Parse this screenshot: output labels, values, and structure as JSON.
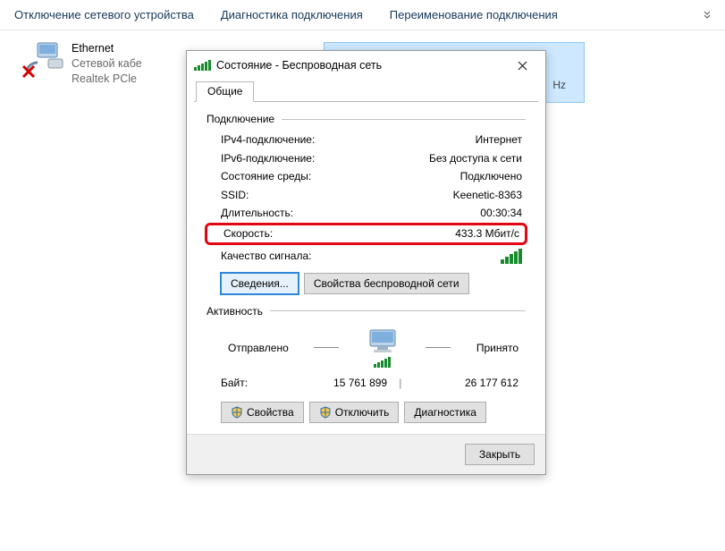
{
  "bg": {
    "toolbar": {
      "disable": "Отключение сетевого устройства",
      "diagnose": "Диагностика подключения",
      "rename": "Переименование подключения"
    },
    "ethernet": {
      "title": "Ethernet",
      "sub1": "Сетевой кабе",
      "sub2": "Realtek PCle"
    },
    "ghost_hz": "Hz"
  },
  "dialog": {
    "title": "Состояние - Беспроводная сеть",
    "tab": "Общие",
    "group_connection": "Подключение",
    "rows": {
      "ipv4_l": "IPv4-подключение:",
      "ipv4_v": "Интернет",
      "ipv6_l": "IPv6-подключение:",
      "ipv6_v": "Без доступа к сети",
      "media_l": "Состояние среды:",
      "media_v": "Подключено",
      "ssid_l": "SSID:",
      "ssid_v": "Keenetic-8363",
      "dur_l": "Длительность:",
      "dur_v": "00:30:34",
      "speed_l": "Скорость:",
      "speed_v": "433.3 Мбит/с",
      "signal_l": "Качество сигнала:"
    },
    "buttons": {
      "details": "Сведения...",
      "wifi_props": "Свойства беспроводной сети"
    },
    "group_activity": "Активность",
    "activity": {
      "sent": "Отправлено",
      "recv": "Принято",
      "bytes_label": "Байт:",
      "bytes_sent": "15 761 899",
      "bytes_recv": "26 177 612"
    },
    "actions": {
      "props": "Свойства",
      "disable": "Отключить",
      "diag": "Диагностика"
    },
    "close": "Закрыть"
  }
}
